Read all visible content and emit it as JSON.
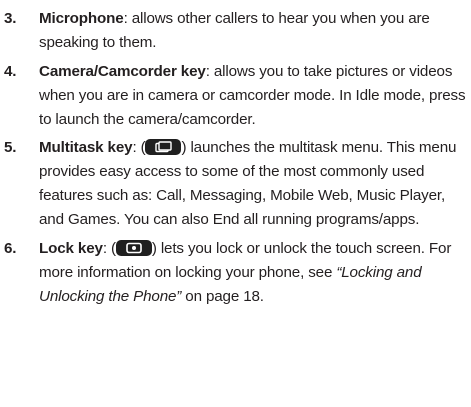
{
  "items": [
    {
      "num": "3.",
      "term": "Microphone",
      "text": ": allows other callers to hear you when you are speaking to them."
    },
    {
      "num": "4.",
      "term": "Camera/Camcorder key",
      "text": ": allows you to take pictures or videos when you are in camera or camcorder mode. In Idle mode, press to launch the camera/camcorder."
    },
    {
      "num": "5.",
      "term": "Multitask key",
      "pre_icon": ": (",
      "icon": "multitask-key-icon",
      "post_icon": ") launches the multitask menu. This menu provides easy access to some of the most commonly used features such as: Call, Messaging, Mobile Web, Music Player, and Games. You can also End all running programs/apps."
    },
    {
      "num": "6.",
      "term": "Lock key",
      "pre_icon": ": (",
      "icon": "lock-key-icon",
      "post_icon": ") lets you lock or unlock the touch screen. For more information on locking your phone, see ",
      "ref": "“Locking and Unlocking the Phone”",
      "tail": " on page 18."
    }
  ],
  "colors": {
    "text": "#231f20",
    "icon_bg": "#1f1f1f",
    "icon_fg": "#ffffff"
  }
}
